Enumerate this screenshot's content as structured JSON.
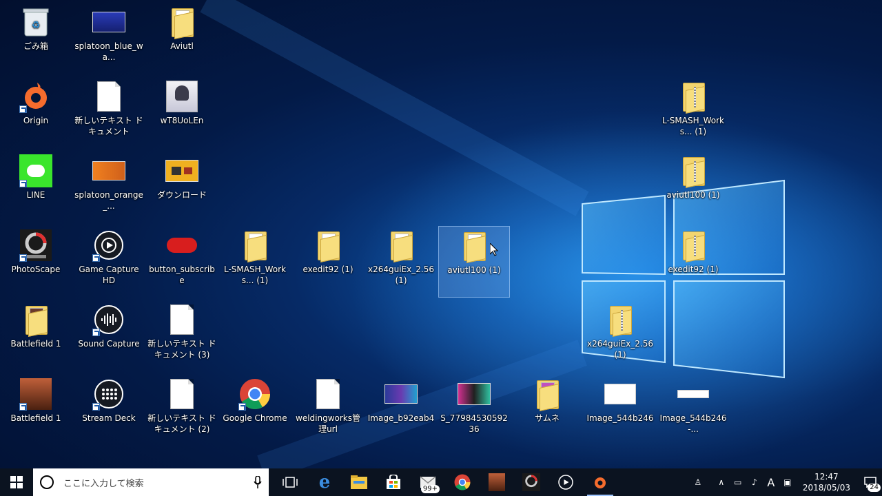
{
  "desktop": {
    "icons": [
      {
        "label": "ごみ箱",
        "type": "recycle"
      },
      {
        "label": "splatoon_blue_wa...",
        "type": "image",
        "color": "#2233aa"
      },
      {
        "label": "Aviutl",
        "type": "folder"
      },
      {
        "label": "Origin",
        "type": "origin"
      },
      {
        "label": "新しいテキスト ドキュメント",
        "type": "doc"
      },
      {
        "label": "wT8UoLEn",
        "type": "image",
        "color": "#d8d8e8"
      },
      {
        "label": "L-SMASH_Works... (1)",
        "type": "zip"
      },
      {
        "label": "LINE",
        "type": "line"
      },
      {
        "label": "splatoon_orange_...",
        "type": "image",
        "color": "#e07010"
      },
      {
        "label": "ダウンロード",
        "type": "image",
        "color": "#f0b020"
      },
      {
        "label": "aviutl100 (1)",
        "type": "zip"
      },
      {
        "label": "PhotoScape",
        "type": "photoscape"
      },
      {
        "label": "Game Capture HD",
        "type": "gamecap"
      },
      {
        "label": "button_subscribe",
        "type": "subscribe"
      },
      {
        "label": "L-SMASH_Works... (1)",
        "type": "folder"
      },
      {
        "label": "exedit92 (1)",
        "type": "folder"
      },
      {
        "label": "x264guiEx_2.56 (1)",
        "type": "folder"
      },
      {
        "label": "aviutl100 (1)",
        "type": "folder",
        "selected": true
      },
      {
        "label": "exedit92 (1)",
        "type": "zip"
      },
      {
        "label": "Battlefield 1",
        "type": "folder"
      },
      {
        "label": "Sound Capture",
        "type": "soundcap"
      },
      {
        "label": "新しいテキスト ドキュメント (3)",
        "type": "doc"
      },
      {
        "label": "x264guiEx_2.56 (1)",
        "type": "zip"
      },
      {
        "label": "Battlefield 1",
        "type": "image",
        "color": "#7a3a20"
      },
      {
        "label": "Stream Deck",
        "type": "streamdeck"
      },
      {
        "label": "新しいテキスト ドキュメント (2)",
        "type": "doc"
      },
      {
        "label": "Google Chrome",
        "type": "chrome"
      },
      {
        "label": "weldingworks管理url",
        "type": "doc"
      },
      {
        "label": "Image_b92eab4",
        "type": "image",
        "color": "#3a4a9a"
      },
      {
        "label": "S_7798453059236",
        "type": "image",
        "color": "#c0308a"
      },
      {
        "label": "サムネ",
        "type": "folder"
      },
      {
        "label": "Image_544b246",
        "type": "image",
        "color": "#ffffff"
      },
      {
        "label": "Image_544b246-...",
        "type": "image",
        "color": "#ffffff"
      }
    ]
  },
  "taskbar": {
    "search_placeholder": "ここに入力して検索",
    "mail_badge": "99+",
    "time": "12:47",
    "date": "2018/05/03",
    "notification_count": "24",
    "ime": "A"
  }
}
